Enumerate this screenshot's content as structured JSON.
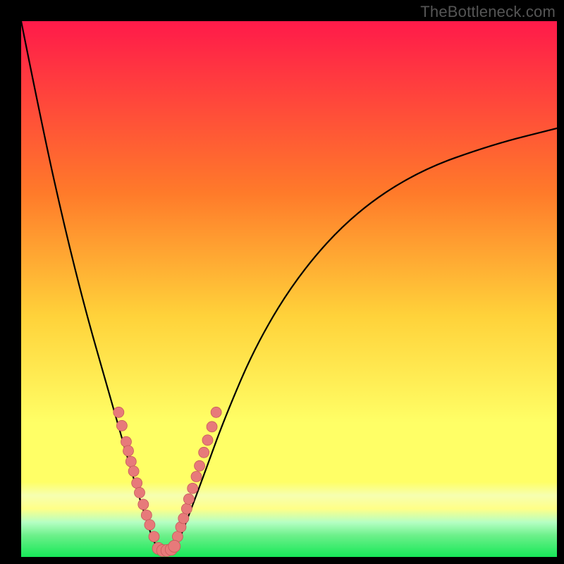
{
  "watermark": "TheBottleneck.com",
  "colors": {
    "frame": "#000000",
    "grad_top": "#ff1a4a",
    "grad_mid1": "#ff7a2a",
    "grad_mid2": "#ffd23a",
    "grad_mid3": "#ffff66",
    "grad_band_pale": "#f6ffb0",
    "grad_green_light": "#6cf08a",
    "grad_green": "#17e858",
    "curve": "#000000",
    "dot_fill": "#e77a7a",
    "dot_stroke": "#c65a5a"
  },
  "chart_data": {
    "type": "line",
    "title": "",
    "xlabel": "",
    "ylabel": "",
    "xlim": [
      0,
      100
    ],
    "ylim": [
      0,
      100
    ],
    "grid": false,
    "note": "V-shaped bottleneck curve. Values are percentages read from normalized plot area (0 = left/bottom, 100 = right/top). Curve minimum ≈ (27, 0).",
    "series": [
      {
        "name": "bottleneck-curve",
        "x": [
          0,
          4,
          8,
          12,
          16,
          20,
          23,
          25,
          27,
          29,
          31,
          34,
          38,
          44,
          52,
          62,
          74,
          88,
          100
        ],
        "y": [
          100,
          80,
          62,
          46,
          32,
          18,
          8,
          2,
          0,
          2,
          7,
          15,
          26,
          40,
          53,
          64,
          72,
          77,
          80
        ]
      }
    ],
    "dots_left": [
      {
        "x": 18.2,
        "y": 27.0
      },
      {
        "x": 18.8,
        "y": 24.5
      },
      {
        "x": 19.6,
        "y": 21.5
      },
      {
        "x": 20.0,
        "y": 19.8
      },
      {
        "x": 20.5,
        "y": 17.8
      },
      {
        "x": 21.0,
        "y": 16.0
      },
      {
        "x": 21.6,
        "y": 13.8
      },
      {
        "x": 22.1,
        "y": 12.0
      },
      {
        "x": 22.8,
        "y": 9.8
      },
      {
        "x": 23.4,
        "y": 7.8
      },
      {
        "x": 24.0,
        "y": 6.0
      },
      {
        "x": 24.8,
        "y": 3.8
      }
    ],
    "dots_right": [
      {
        "x": 29.2,
        "y": 3.8
      },
      {
        "x": 29.8,
        "y": 5.6
      },
      {
        "x": 30.3,
        "y": 7.2
      },
      {
        "x": 30.9,
        "y": 9.0
      },
      {
        "x": 31.3,
        "y": 10.8
      },
      {
        "x": 32.0,
        "y": 12.8
      },
      {
        "x": 32.7,
        "y": 15.0
      },
      {
        "x": 33.3,
        "y": 17.0
      },
      {
        "x": 34.1,
        "y": 19.5
      },
      {
        "x": 34.8,
        "y": 21.8
      },
      {
        "x": 35.6,
        "y": 24.3
      },
      {
        "x": 36.4,
        "y": 27.0
      }
    ],
    "dots_bottom": [
      {
        "x": 25.6,
        "y": 1.6
      },
      {
        "x": 26.4,
        "y": 1.2
      },
      {
        "x": 27.2,
        "y": 1.2
      },
      {
        "x": 28.0,
        "y": 1.4
      },
      {
        "x": 28.6,
        "y": 2.0
      }
    ]
  }
}
